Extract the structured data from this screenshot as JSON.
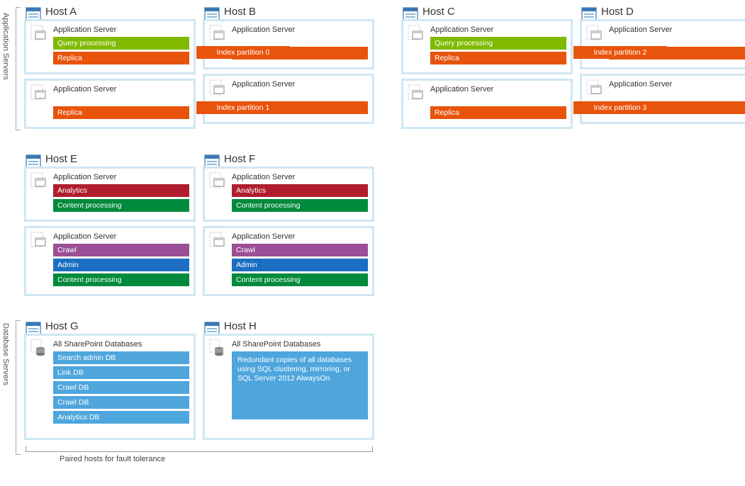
{
  "section_labels": {
    "app": "Application Servers",
    "db": "Database Servers"
  },
  "hosts": {
    "A": "Host A",
    "B": "Host B",
    "C": "Host C",
    "D": "Host D",
    "E": "Host E",
    "F": "Host F",
    "G": "Host G",
    "H": "Host H"
  },
  "titles": {
    "app_server": "Application Server",
    "all_db": "All SharePoint Databases"
  },
  "bars": {
    "query": "Query processing",
    "replica": "Replica",
    "analytics": "Analytics",
    "content": "Content processing",
    "crawl": "Crawl",
    "admin": "Admin",
    "search_admin_db": "Search admin DB",
    "link_db": "Link DB",
    "crawl_db": "Crawl DB",
    "analytics_db": "Analytics DB"
  },
  "partitions": {
    "p0": "Index partition 0",
    "p1": "Index partition 1",
    "p2": "Index partition 2",
    "p3": "Index partition 3"
  },
  "db_desc": "Redundant copies of all databases using SQL clustering, mirroring, or SQL Server 2012 AlwaysOn",
  "footer": "Paired hosts for fault tolerance"
}
